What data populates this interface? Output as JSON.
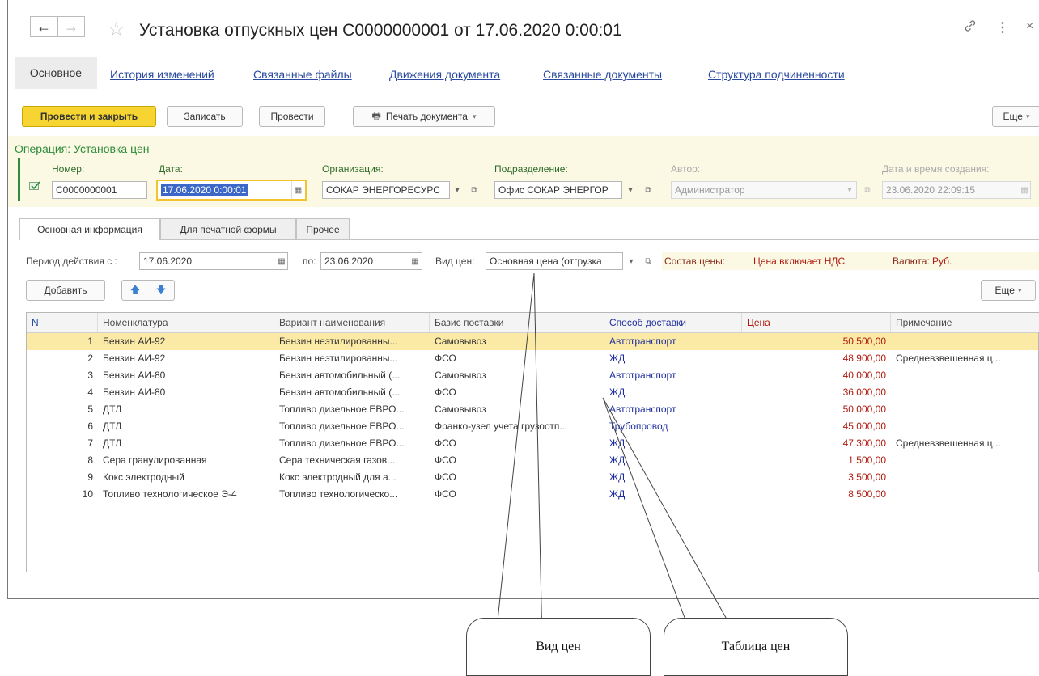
{
  "window": {
    "title": "Установка отпускных цен С0000000001 от 17.06.2020 0:00:01"
  },
  "nav": {
    "back": "←",
    "forward": "→"
  },
  "tabs": {
    "main": "Основное",
    "links": [
      "История изменений",
      "Связанные файлы",
      "Движения документа",
      "Связанные документы",
      "Структура подчиненности"
    ]
  },
  "toolbar": {
    "post_close": "Провести и закрыть",
    "save": "Записать",
    "post": "Провести",
    "print": "Печать документа",
    "more": "Еще"
  },
  "operation": {
    "title": "Операция: Установка цен",
    "number_label": "Номер:",
    "number": "С0000000001",
    "date_label": "Дата:",
    "date": "17.06.2020  0:00:01",
    "org_label": "Организация:",
    "org": "СОКАР ЭНЕРГОРЕСУРС",
    "dept_label": "Подразделение:",
    "dept": "Офис СОКАР ЭНЕРГОР",
    "author_label": "Автор:",
    "author": "Администратор",
    "created_label": "Дата и время создания:",
    "created": "23.06.2020 22:09:15"
  },
  "subtabs": [
    "Основная информация",
    "Для печатной формы",
    "Прочее"
  ],
  "filters": {
    "period_label": "Период действия с :",
    "period_from": "17.06.2020",
    "to_label": "по:",
    "period_to": "23.06.2020",
    "price_type_label": "Вид цен:",
    "price_type": "Основная цена (отгрузка",
    "composition_label": "Состав цены:",
    "composition": "Цена включает НДС",
    "currency_label": "Валюта:",
    "currency": "Руб."
  },
  "table_toolbar": {
    "add": "Добавить",
    "more": "Еще"
  },
  "table": {
    "columns": [
      "N",
      "Номенклатура",
      "Вариант наименования",
      "Базис поставки",
      "Способ доставки",
      "Цена",
      "Примечание"
    ],
    "rows": [
      {
        "n": "1",
        "nom": "Бензин АИ-92",
        "var": "Бензин неэтилированны...",
        "bas": "Самовывоз",
        "spo": "Автотранспорт",
        "pri": "50 500,00",
        "pr": ""
      },
      {
        "n": "2",
        "nom": "Бензин АИ-92",
        "var": "Бензин неэтилированны...",
        "bas": "ФСО",
        "spo": "ЖД",
        "pri": "48 900,00",
        "pr": "Средневзвешенная ц..."
      },
      {
        "n": "3",
        "nom": "Бензин АИ-80",
        "var": "Бензин автомобильный (...",
        "bas": "Самовывоз",
        "spo": "Автотранспорт",
        "pri": "40 000,00",
        "pr": ""
      },
      {
        "n": "4",
        "nom": "Бензин АИ-80",
        "var": "Бензин автомобильный (...",
        "bas": "ФСО",
        "spo": "ЖД",
        "pri": "36 000,00",
        "pr": ""
      },
      {
        "n": "5",
        "nom": "ДТЛ",
        "var": "Топливо дизельное ЕВРО...",
        "bas": "Самовывоз",
        "spo": "Автотранспорт",
        "pri": "50 000,00",
        "pr": ""
      },
      {
        "n": "6",
        "nom": "ДТЛ",
        "var": "Топливо дизельное ЕВРО...",
        "bas": "Франко-узел учета грузоотп...",
        "spo": "Трубопровод",
        "pri": "45 000,00",
        "pr": ""
      },
      {
        "n": "7",
        "nom": "ДТЛ",
        "var": "Топливо дизельное ЕВРО...",
        "bas": "ФСО",
        "spo": "ЖД",
        "pri": "47 300,00",
        "pr": "Средневзвешенная ц..."
      },
      {
        "n": "8",
        "nom": "Сера гранулированная",
        "var": "Сера техническая газов...",
        "bas": "ФСО",
        "spo": "ЖД",
        "pri": "1 500,00",
        "pr": ""
      },
      {
        "n": "9",
        "nom": "Кокс электродный",
        "var": "Кокс электродный для а...",
        "bas": "ФСО",
        "spo": "ЖД",
        "pri": "3 500,00",
        "pr": ""
      },
      {
        "n": "10",
        "nom": "Топливо технологическое Э-4",
        "var": "Топливо технологическо...",
        "bas": "ФСО",
        "spo": "ЖД",
        "pri": "8 500,00",
        "pr": ""
      }
    ]
  },
  "callouts": {
    "price_type": "Вид цен",
    "price_table": "Таблица цен"
  },
  "colors": {
    "primary_button": "#f6d431",
    "operation_green": "#2e8b3a",
    "link_blue": "#2a4ba0",
    "price_red": "#b01a0e",
    "selected_row": "#fbe9a6"
  }
}
